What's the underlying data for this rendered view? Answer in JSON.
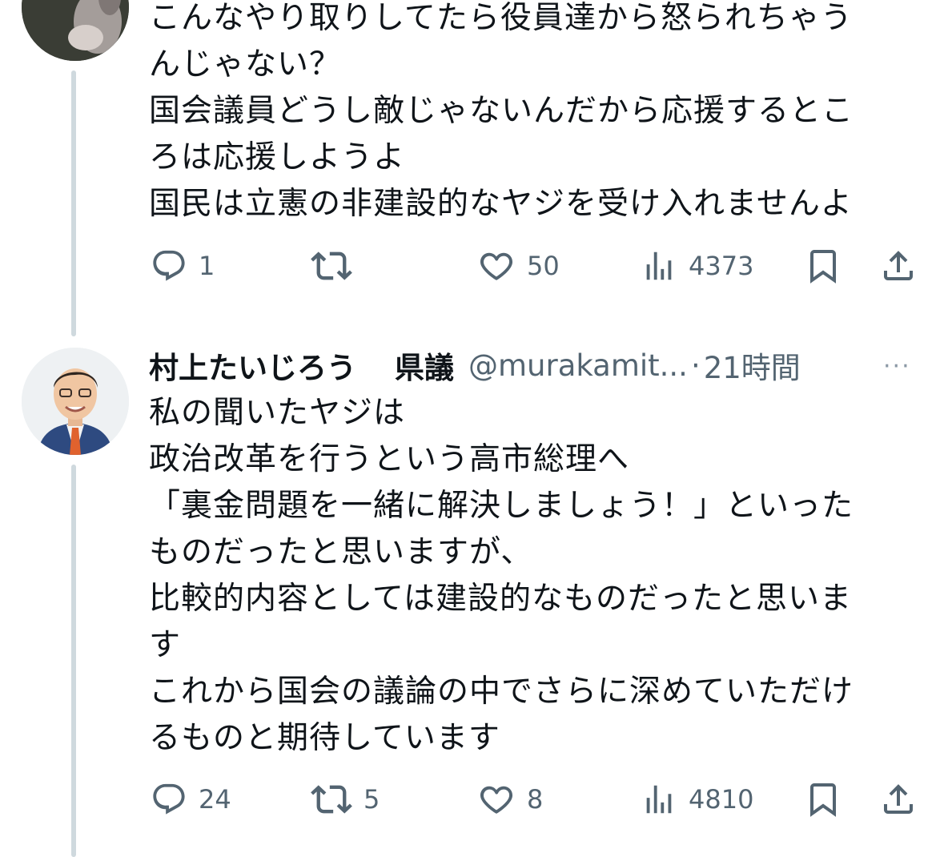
{
  "posts": [
    {
      "body": "こんなやり取りしてたら役員達から怒られちゃう\nんじゃない？\n国会議員どうし敵じゃないんだから応援するとこ\nろは応援しようよ\n国民は立憲の非建設的なヤジを受け入れませんよ",
      "replies": "1",
      "reposts": "",
      "likes": "50",
      "views": "4373"
    },
    {
      "name": "村上たいじろう",
      "title": "県議",
      "handle": "@murakamit...",
      "separator": "·",
      "time": "21時間",
      "more": "···",
      "body": "私の聞いたヤジは\n政治改革を行うという高市総理へ\n「裏金問題を一緒に解決しましょう！」といった\nものだったと思いますが、\n比較的内容としては建設的なものだったと思いま\nす\nこれから国会の議論の中でさらに深めていただけ\nるものと期待しています",
      "replies": "24",
      "reposts": "5",
      "likes": "8",
      "views": "4810"
    }
  ],
  "icons": {
    "reply": "reply-icon",
    "repost": "repost-icon",
    "like": "heart-icon",
    "views": "views-icon",
    "bookmark": "bookmark-icon",
    "share": "share-icon"
  },
  "colors": {
    "text": "#0f1419",
    "secondary": "#536471",
    "thread_line": "#cfd9de",
    "background": "#ffffff"
  }
}
